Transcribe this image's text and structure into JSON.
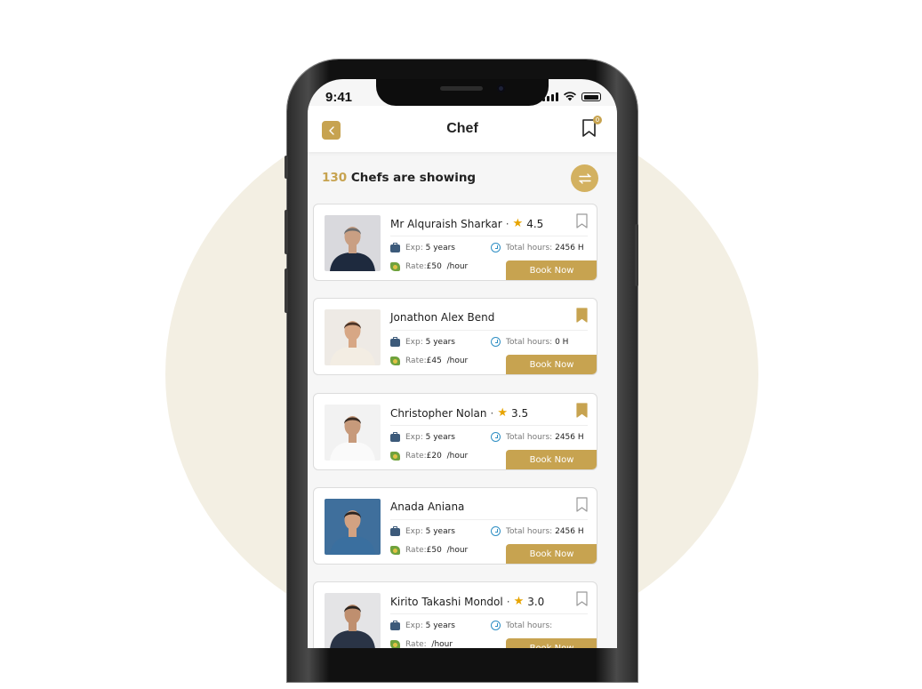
{
  "status": {
    "time": "9:41"
  },
  "header": {
    "title": "Chef",
    "bookmark_count": "0"
  },
  "summary": {
    "count": "130",
    "label": "Chefs are showing"
  },
  "labels": {
    "exp": "Exp:",
    "total_hours": "Total hours:",
    "rate": "Rate:",
    "per_hour": "/hour",
    "book_now": "Book Now",
    "star": "★"
  },
  "chefs": [
    {
      "name": "Mr Alquraish Sharkar",
      "rating": "4.5",
      "exp": "5 years",
      "hours": "2456 H",
      "rate": "£50",
      "bookmarked": false
    },
    {
      "name": "Jonathon Alex Bend",
      "rating": "",
      "exp": "5 years",
      "hours": "0 H",
      "rate": "£45",
      "bookmarked": true
    },
    {
      "name": "Christopher Nolan",
      "rating": "3.5",
      "exp": "5 years",
      "hours": "2456 H",
      "rate": "£20",
      "bookmarked": true
    },
    {
      "name": "Anada Aniana",
      "rating": "",
      "exp": "5 years",
      "hours": "2456 H",
      "rate": "£50",
      "bookmarked": false
    },
    {
      "name": "Kirito Takashi Mondol",
      "rating": "3.0",
      "exp": "5 years",
      "hours": "",
      "rate": "",
      "bookmarked": false
    }
  ],
  "colors": {
    "accent": "#c7a350",
    "background_circle": "#f3efe3",
    "star": "#e7a400"
  }
}
